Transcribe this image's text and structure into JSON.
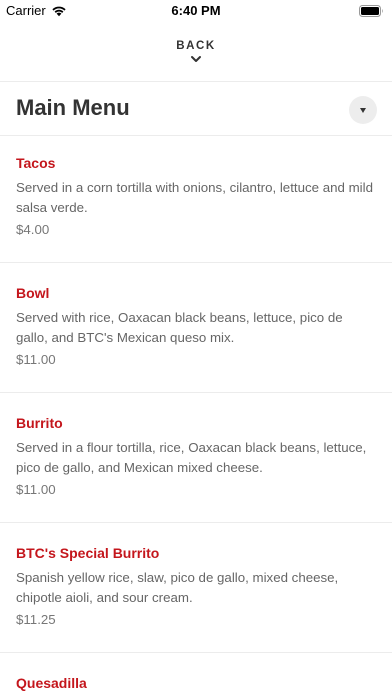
{
  "status_bar": {
    "carrier": "Carrier",
    "time": "6:40 PM"
  },
  "nav": {
    "back_label": "BACK"
  },
  "menu": {
    "title": "Main Menu",
    "items": [
      {
        "name": "Tacos",
        "description": "Served in a corn tortilla with onions, cilantro, lettuce and mild salsa verde.",
        "price": "$4.00"
      },
      {
        "name": "Bowl",
        "description": "Served with rice, Oaxacan black beans, lettuce, pico de gallo, and BTC's Mexican queso mix.",
        "price": "$11.00"
      },
      {
        "name": "Burrito",
        "description": "Served in a flour tortilla, rice, Oaxacan black beans, lettuce, pico de gallo, and Mexican mixed cheese.",
        "price": "$11.00"
      },
      {
        "name": "BTC's Special Burrito",
        "description": "Spanish yellow rice, slaw, pico de gallo, mixed cheese, chipotle aioli, and sour cream.",
        "price": "$11.25"
      },
      {
        "name": "Quesadilla",
        "description": "",
        "price": ""
      }
    ]
  },
  "colors": {
    "accent": "#c4161c",
    "divider": "#ececec",
    "dropdown_bg": "#ededed"
  }
}
